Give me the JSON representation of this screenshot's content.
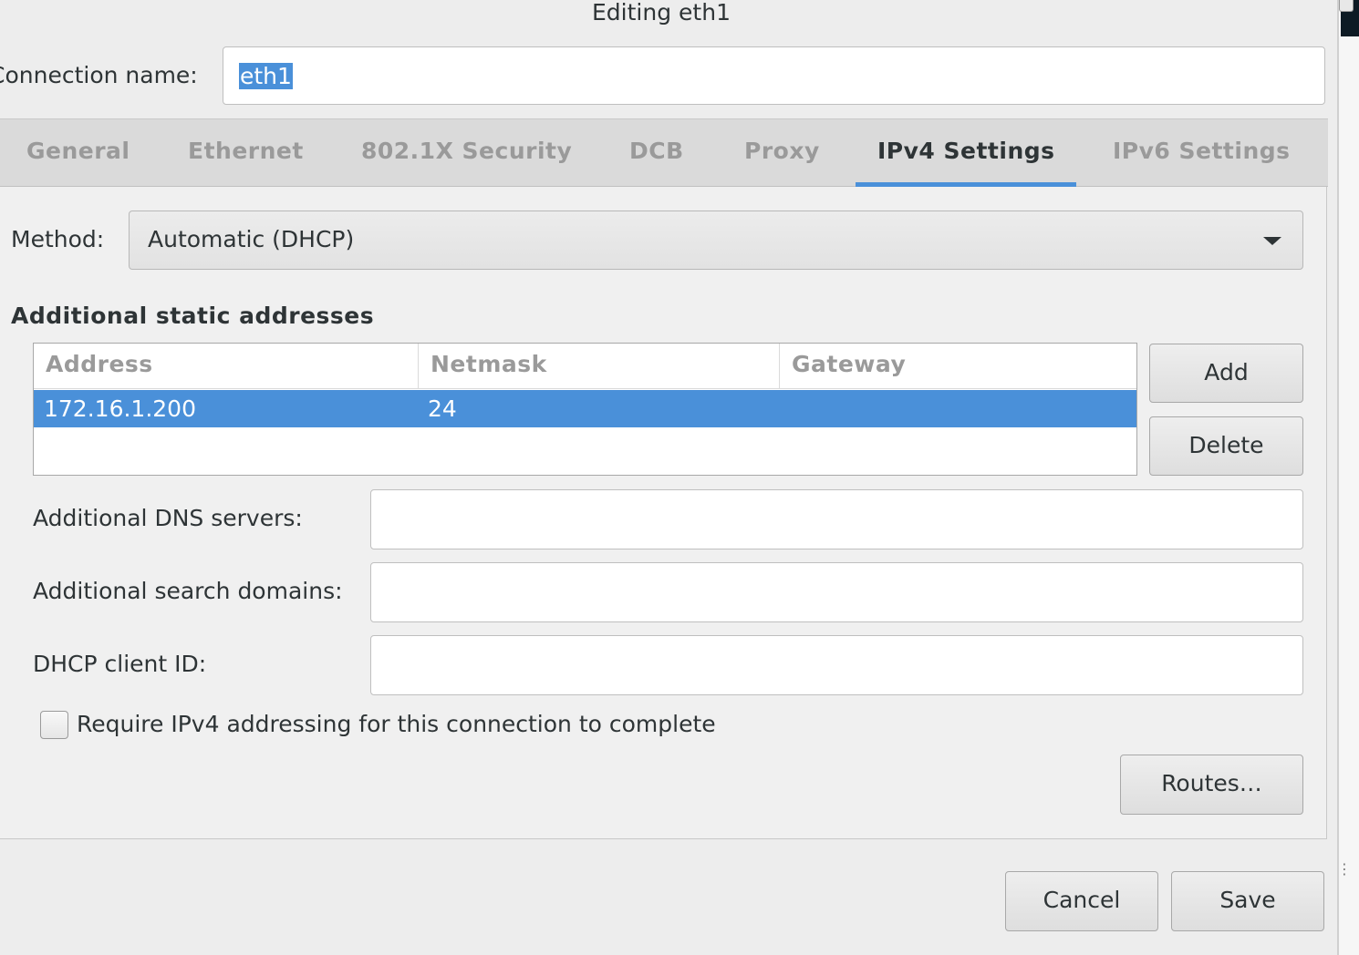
{
  "window": {
    "title": "Editing eth1"
  },
  "connection": {
    "label": "Connection name:",
    "value": "eth1"
  },
  "tabs": [
    {
      "label": "General"
    },
    {
      "label": "Ethernet"
    },
    {
      "label": "802.1X Security"
    },
    {
      "label": "DCB"
    },
    {
      "label": "Proxy"
    },
    {
      "label": "IPv4 Settings",
      "active": true
    },
    {
      "label": "IPv6 Settings"
    }
  ],
  "ipv4": {
    "method_label": "Method:",
    "method_value": "Automatic (DHCP)",
    "static_title": "Additional static addresses",
    "columns": [
      "Address",
      "Netmask",
      "Gateway"
    ],
    "rows": [
      {
        "address": "172.16.1.200",
        "netmask": "24",
        "gateway": ""
      }
    ],
    "add_label": "Add",
    "delete_label": "Delete",
    "dns_label": "Additional DNS servers:",
    "dns_value": "",
    "search_label": "Additional search domains:",
    "search_value": "",
    "client_id_label": "DHCP client ID:",
    "client_id_value": "",
    "require_label": "Require IPv4 addressing for this connection to complete",
    "require_checked": false,
    "routes_label": "Routes…"
  },
  "footer": {
    "cancel_label": "Cancel",
    "save_label": "Save"
  },
  "colors": {
    "accent": "#4a90d9",
    "tab_active": "#2e3436",
    "tab_inactive": "#9a9a9a"
  }
}
